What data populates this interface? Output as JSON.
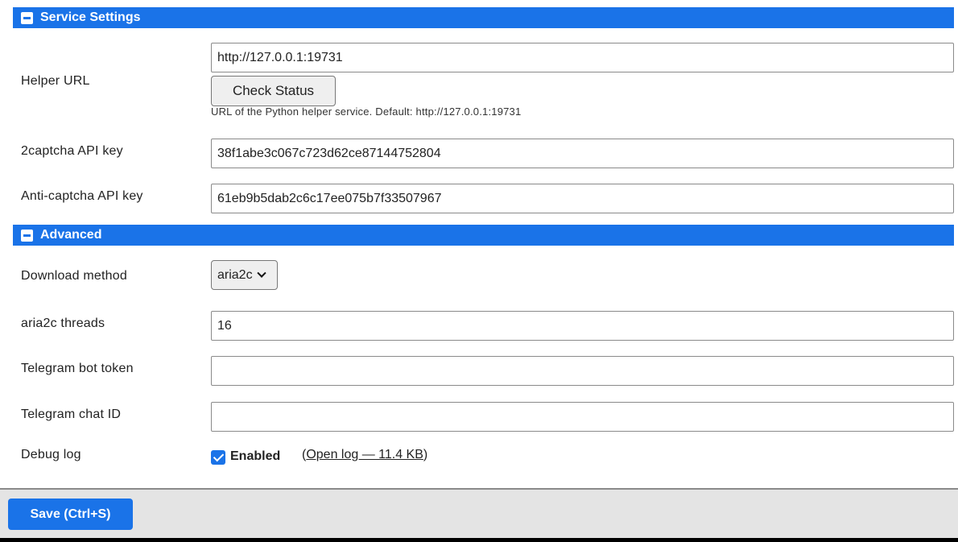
{
  "colors": {
    "accent": "#1a73e8",
    "header_icon_dash": "#1a73e8"
  },
  "service_settings": {
    "title": "Service Settings",
    "helper_url": {
      "label": "Helper URL",
      "value": "http://127.0.0.1:19731",
      "check_button": "Check Status",
      "hint": "URL of the Python helper service. Default: http://127.0.0.1:19731"
    },
    "twocaptcha": {
      "label": "2captcha API key",
      "value": "38f1abe3c067c723d62ce87144752804"
    },
    "anticaptcha": {
      "label": "Anti-captcha API key",
      "value": "61eb9b5dab2c6c17ee075b7f33507967"
    }
  },
  "advanced": {
    "title": "Advanced",
    "download_method": {
      "label": "Download method",
      "selected": "aria2c"
    },
    "aria2c_threads": {
      "label": "aria2c threads",
      "value": "16"
    },
    "telegram_token": {
      "label": "Telegram bot token",
      "value": ""
    },
    "telegram_chat": {
      "label": "Telegram chat ID",
      "value": ""
    },
    "debug_log": {
      "label": "Debug log",
      "checkbox_label": "Enabled",
      "checked": true,
      "paren_open": "(",
      "link_text": "Open log — 11.4 KB",
      "paren_close": ")"
    }
  },
  "footer": {
    "save_label": "Save (Ctrl+S)"
  }
}
